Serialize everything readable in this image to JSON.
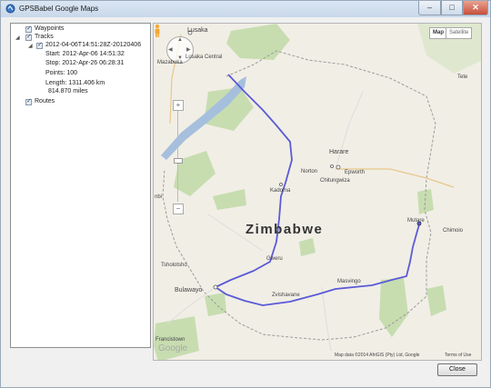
{
  "window": {
    "title": "GPSBabel Google Maps",
    "buttons": {
      "minimize": "–",
      "maximize": "□",
      "close": "✕"
    }
  },
  "tree": {
    "waypoints": {
      "label": "Waypoints",
      "checked": true
    },
    "tracks": {
      "label": "Tracks",
      "checked": true,
      "track": {
        "label": "2012-04-06T14:51:28Z-20120406",
        "checked": true,
        "start": "Start: 2012-Apr-06 14:51:32",
        "stop": "Stop: 2012-Apr-26 06:28:31",
        "points": "Points: 100",
        "length": "Length: 1311.406 km",
        "miles": "814.870 miles"
      }
    },
    "routes": {
      "label": "Routes",
      "checked": true
    }
  },
  "map": {
    "type_buttons": {
      "map": "Map",
      "satellite": "Satellite"
    },
    "country": "Zimbabwe",
    "places": {
      "lusaka": "Lusaka",
      "lusaka_central": "Lusaka Central",
      "mazabuka": "Mazabuka",
      "tete": "Tete",
      "harare": "Harare",
      "norton": "Norton",
      "epworth": "Epworth",
      "chitungwiza": "Chitungwiza",
      "kadoma": "Kadoma",
      "mutare": "Mutare",
      "chimoio": "Chimoio",
      "gweru": "Gweru",
      "masvingo": "Masvingo",
      "zvishavane": "Zvishavane",
      "bulawayo": "Bulawayo",
      "tsholotsho": "Tsholotsho",
      "francistown": "Francistown",
      "nbi": "nbi"
    },
    "logo": "Google",
    "attribution": "Map data ©2014 AfriGIS (Pty) Ltd, Google",
    "terms": "Terms of Use",
    "track_color": "#5a5bd6",
    "water_color": "#a5bfdd",
    "park_color": "#c7ddb0"
  },
  "footer": {
    "close_label": "Close"
  }
}
